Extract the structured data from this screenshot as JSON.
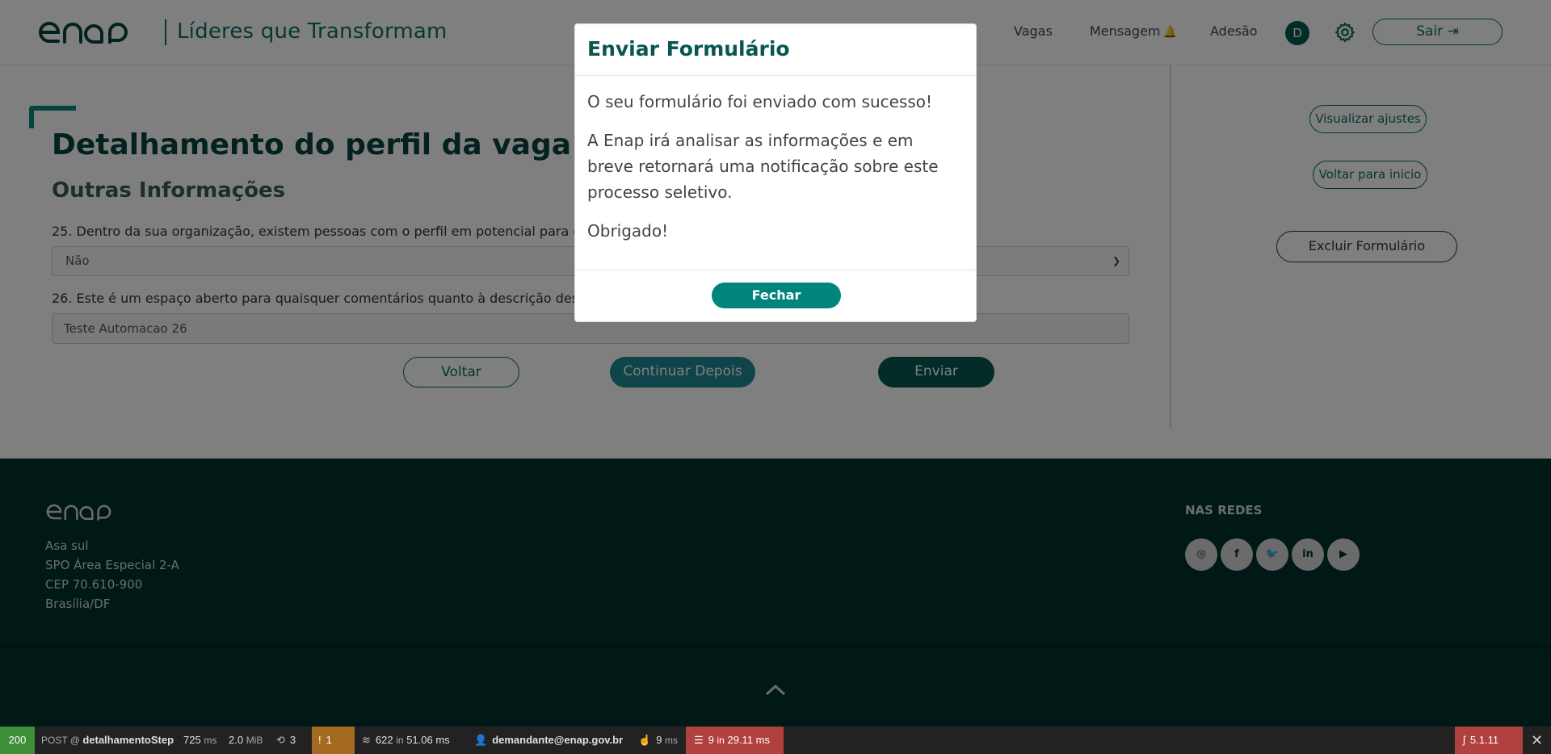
{
  "header": {
    "site_title": "Líderes que Transformam",
    "nav": {
      "vagas": "Vagas",
      "mensagem": "Mensagem",
      "adesao": "Adesão"
    },
    "avatar_initial": "D",
    "sair_label": "Sair"
  },
  "main": {
    "page_title": "Detalhamento do perfil da vaga",
    "section_title": "Outras Informações",
    "q25": {
      "label": "25. Dentro da sua organização, existem pessoas com o perfil em potencial para ocupar",
      "value": "Não"
    },
    "q26": {
      "label": "26. Este é um espaço aberto para quaisquer comentários quanto à descrição deste perfi",
      "value": "Teste Automacao 26"
    },
    "buttons": {
      "voltar": "Voltar",
      "continuar": "Continuar Depois",
      "enviar": "Enviar"
    }
  },
  "sidebar": {
    "visualizar": "Visualizar ajustes",
    "voltar_inicio": "Voltar para inicio",
    "excluir": "Excluir Formulário"
  },
  "footer": {
    "address": [
      "Asa sul",
      "SPO Área Especial 2-A",
      "CEP 70.610-900",
      "Brasília/DF"
    ],
    "redes_title": "NAS REDES"
  },
  "modal": {
    "title": "Enviar Formulário",
    "p1": "O seu formulário foi enviado com sucesso!",
    "p2": "A Enap irá analisar as informações e em breve retornará uma notificação sobre este processo seletivo.",
    "p3": "Obrigado!",
    "close_label": "Fechar"
  },
  "toolbar": {
    "status": "200",
    "method": "POST",
    "route": "detalhamentoStep",
    "time": "725",
    "time_unit": "ms",
    "memory": "2.0",
    "memory_unit": "MiB",
    "routes": "3",
    "warnings": "1",
    "twig": "622",
    "twig_time": "51.06 ms",
    "user": "demandante@enap.gov.br",
    "events": "9",
    "events_unit": "ms",
    "db": "9",
    "db_time": "29.11 ms",
    "sf_version": "5.1.11"
  },
  "colors": {
    "primary": "#075750",
    "accent": "#00857d",
    "footer": "#00332f",
    "danger": "#b0413e"
  }
}
